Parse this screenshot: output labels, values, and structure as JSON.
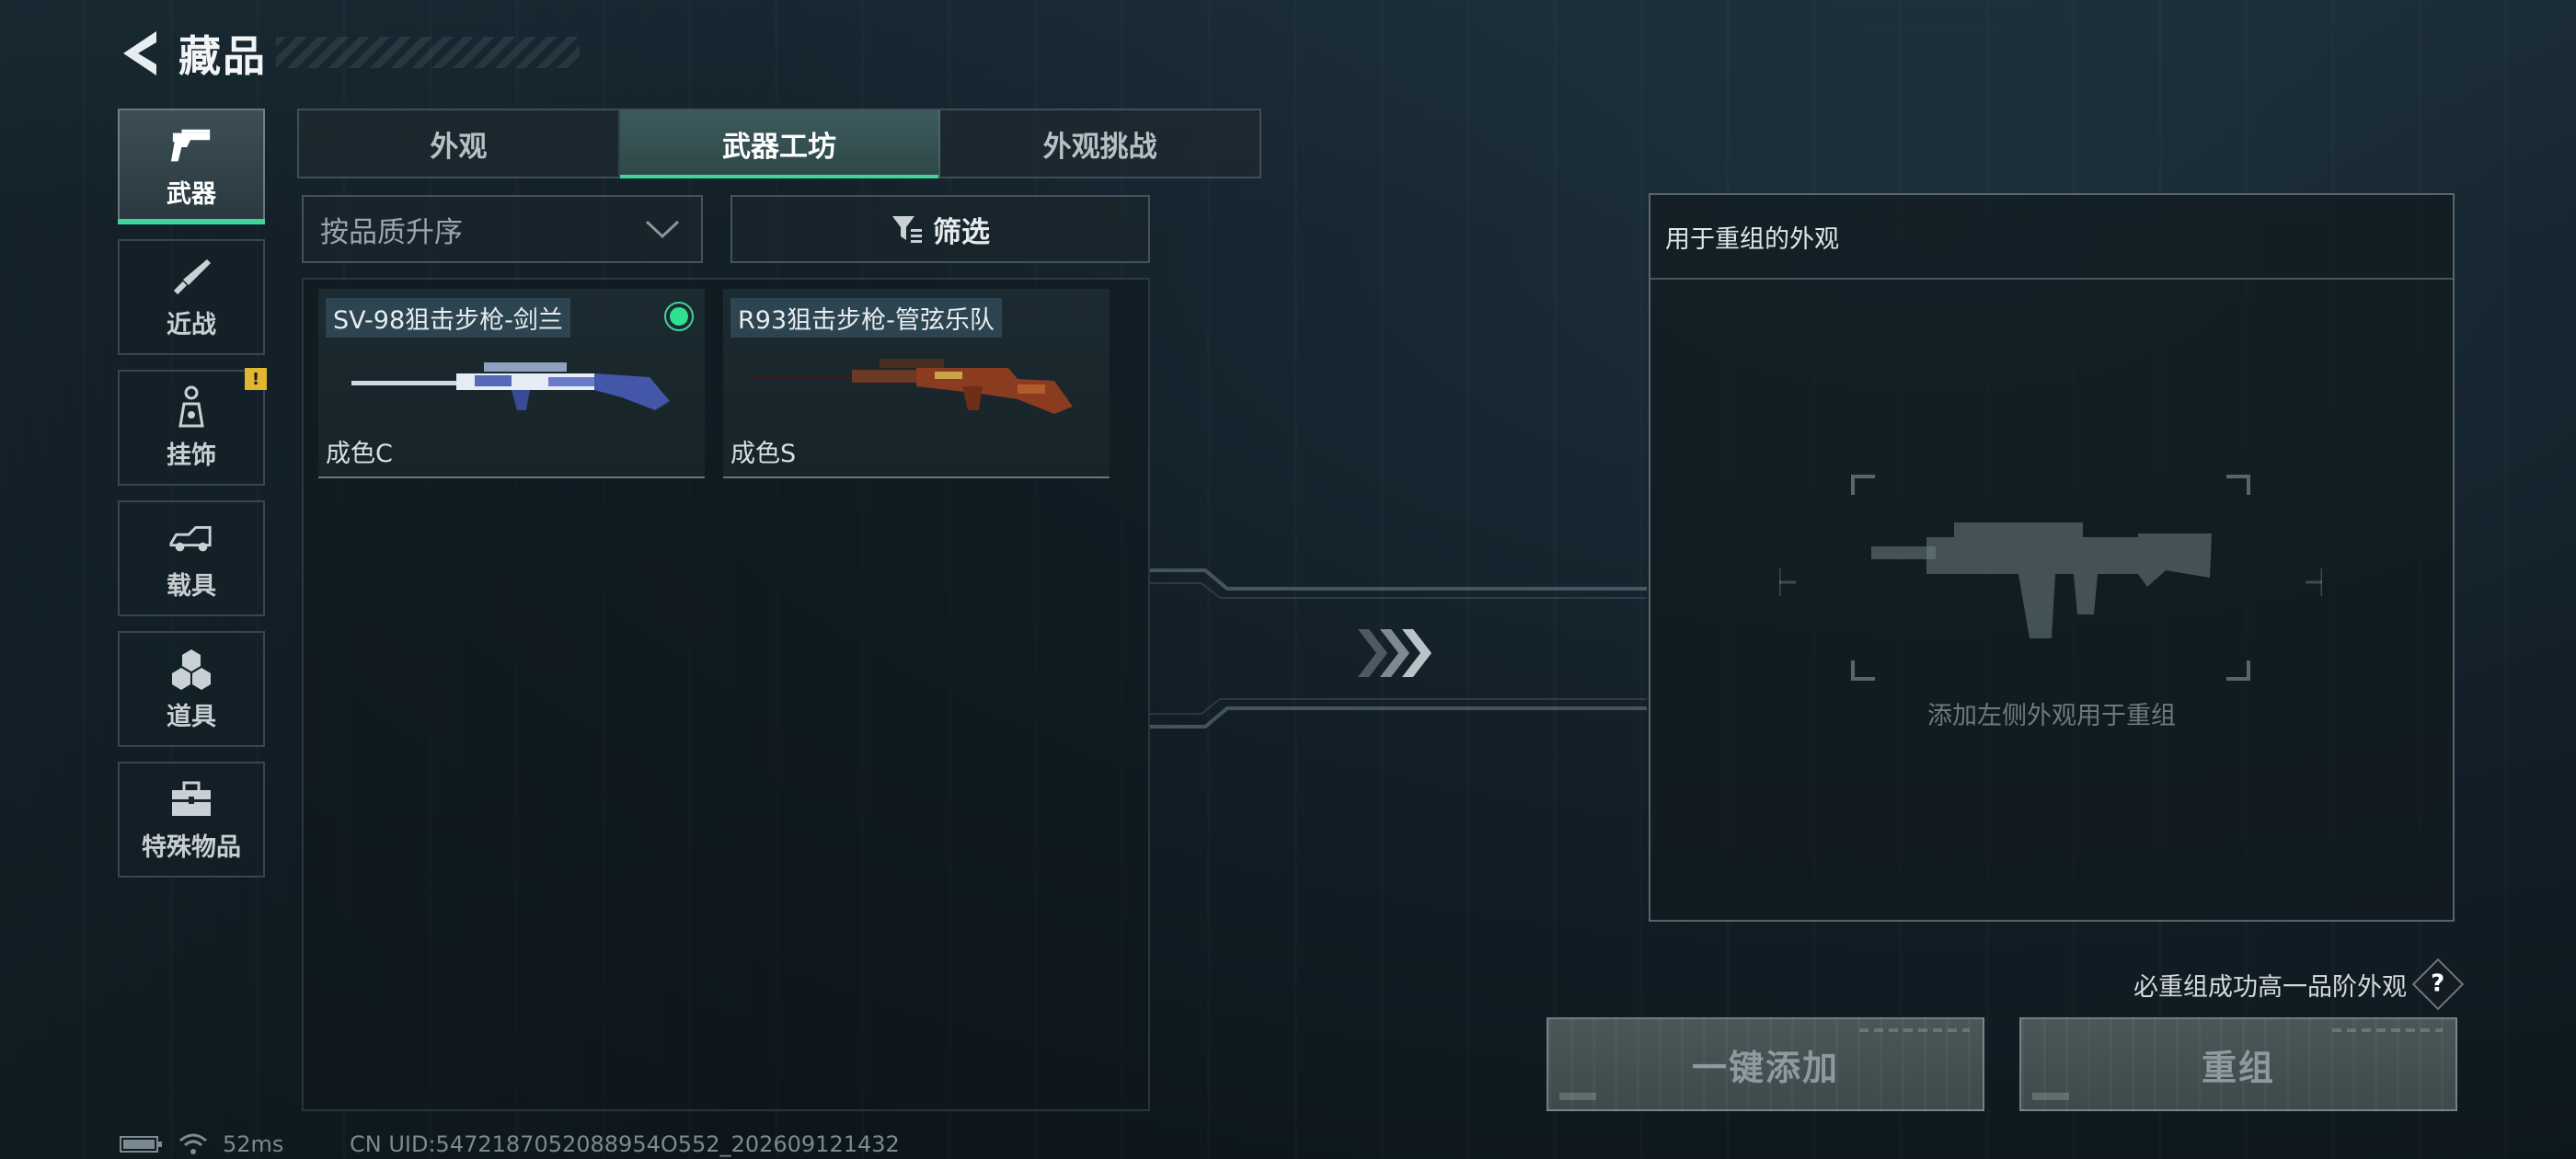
{
  "header": {
    "title": "藏品"
  },
  "categories": [
    {
      "label": "武器",
      "icon": "pistol-icon",
      "active": true
    },
    {
      "label": "近战",
      "icon": "knife-icon"
    },
    {
      "label": "挂饰",
      "icon": "charm-icon",
      "badge": "!"
    },
    {
      "label": "载具",
      "icon": "vehicle-icon"
    },
    {
      "label": "道具",
      "icon": "grenades-icon"
    },
    {
      "label": "特殊物品",
      "icon": "toolbox-icon"
    }
  ],
  "tabs": [
    {
      "label": "外观"
    },
    {
      "label": "武器工坊",
      "active": true
    },
    {
      "label": "外观挑战"
    }
  ],
  "sort": {
    "selected": "按品质升序"
  },
  "filter": {
    "label": "筛选"
  },
  "items": [
    {
      "name": "SV-98狙击步枪-剑兰",
      "grade": "成色C",
      "equipped": true
    },
    {
      "name": "R93狙击步枪-管弦乐队",
      "grade": "成色S",
      "equipped": false
    }
  ],
  "reorg": {
    "title": "用于重组的外观",
    "hint": "添加左侧外观用于重组"
  },
  "guarantee": {
    "text": "必重组成功高一品阶外观",
    "help": "?"
  },
  "actions": {
    "add_all": "一键添加",
    "reorganize": "重组"
  },
  "status": {
    "ping": "52ms",
    "uid": "CN UID:5472187052088954O552_202609121432"
  },
  "colors": {
    "accent": "#3ed49a",
    "badge": "#e2b531"
  }
}
